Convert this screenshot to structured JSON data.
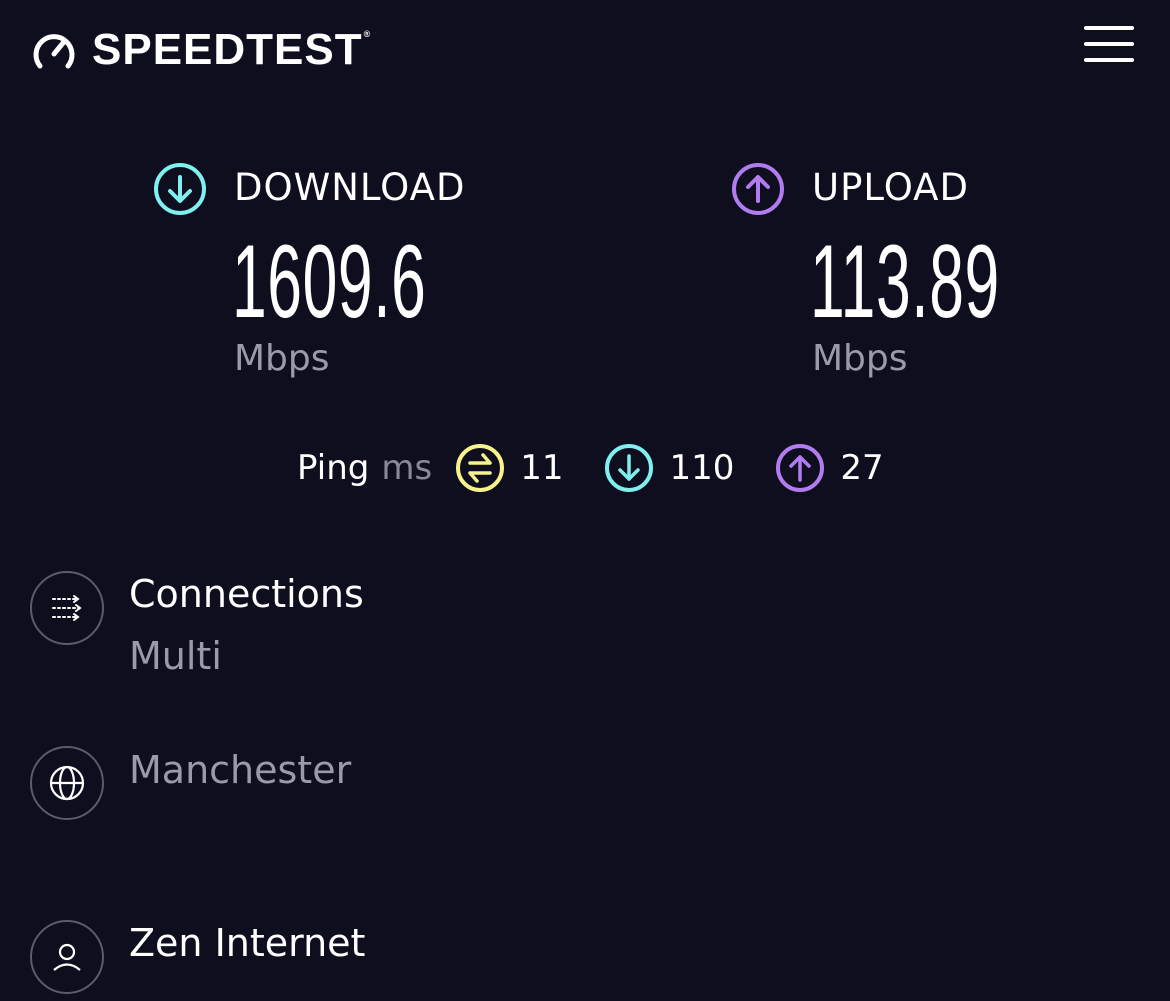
{
  "header": {
    "brand": "SPEEDTEST",
    "trademark": "®",
    "logo_icon": "speedometer-icon",
    "menu_icon": "hamburger-menu-icon"
  },
  "colors": {
    "background": "#0f0e1f",
    "download": "#7ff0ee",
    "upload": "#b27cf1",
    "ping_idle": "#f7f28c",
    "muted": "#9b9aab"
  },
  "results": {
    "download": {
      "label": "DOWNLOAD",
      "value": "1609.6",
      "unit": "Mbps",
      "icon": "arrow-down-circle-icon"
    },
    "upload": {
      "label": "UPLOAD",
      "value": "113.89",
      "unit": "Mbps",
      "icon": "arrow-up-circle-icon"
    }
  },
  "ping": {
    "label": "Ping",
    "unit": "ms",
    "idle": {
      "value": "11",
      "icon": "swap-arrows-circle-icon"
    },
    "download": {
      "value": "110",
      "icon": "arrow-down-circle-icon"
    },
    "upload": {
      "value": "27",
      "icon": "arrow-up-circle-icon"
    }
  },
  "info": {
    "connections": {
      "title": "Connections",
      "value": "Multi",
      "icon": "connections-icon"
    },
    "server": {
      "title": "Manchester",
      "icon": "globe-icon"
    },
    "provider": {
      "title": "Zen Internet",
      "icon": "user-icon"
    }
  }
}
